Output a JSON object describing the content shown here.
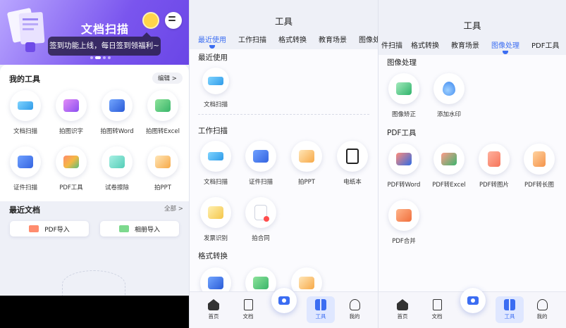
{
  "home": {
    "hero_title": "文档扫描",
    "tooltip": "签到功能上线，每日签到领福利~",
    "my_tools_title": "我的工具",
    "edit_label": "编辑 >",
    "tools": [
      {
        "label": "文档扫描",
        "icon": "printer-icon"
      },
      {
        "label": "拍图识字",
        "icon": "text-recognition-icon"
      },
      {
        "label": "拍图转Word",
        "icon": "word-icon"
      },
      {
        "label": "拍图转Excel",
        "icon": "excel-icon"
      },
      {
        "label": "证件扫描",
        "icon": "id-card-icon"
      },
      {
        "label": "PDF工具",
        "icon": "pdf-tools-icon"
      },
      {
        "label": "试卷擦除",
        "icon": "eraser-icon"
      },
      {
        "label": "拍PPT",
        "icon": "ppt-icon"
      }
    ],
    "recent_title": "最近文档",
    "all_label": "全部 >",
    "pdf_import": "PDF导入",
    "album_import": "相册导入"
  },
  "tools_page": {
    "title": "工具",
    "tabs_p2": [
      "最近使用",
      "工作扫描",
      "格式转换",
      "教育场景",
      "图像处"
    ],
    "tabs_p3": [
      "件扫描",
      "格式转换",
      "教育场景",
      "图像处理",
      "PDF工具"
    ],
    "sections_p2": {
      "recent": "最近使用",
      "work": "工作扫描",
      "format": "格式转换"
    },
    "recent_tools": [
      {
        "label": "文档扫描"
      }
    ],
    "work_tools": [
      {
        "label": "文档扫描"
      },
      {
        "label": "证件扫描"
      },
      {
        "label": "拍PPT"
      },
      {
        "label": "电纸本"
      },
      {
        "label": "发票识别"
      },
      {
        "label": "拍合同"
      }
    ],
    "sections_p3": {
      "image": "图像处理",
      "pdf": "PDF工具"
    },
    "image_tools": [
      {
        "label": "图像矫正"
      },
      {
        "label": "添加水印"
      }
    ],
    "pdf_tools": [
      {
        "label": "PDF转Word"
      },
      {
        "label": "PDF转Excel"
      },
      {
        "label": "PDF转图片"
      },
      {
        "label": "PDF转长图"
      },
      {
        "label": "PDF合并"
      }
    ]
  },
  "nav": {
    "home": "首页",
    "docs": "文档",
    "tools": "工具",
    "me": "我的"
  },
  "colors": {
    "accent": "#3b6df2",
    "hero": "#7a55ee"
  }
}
